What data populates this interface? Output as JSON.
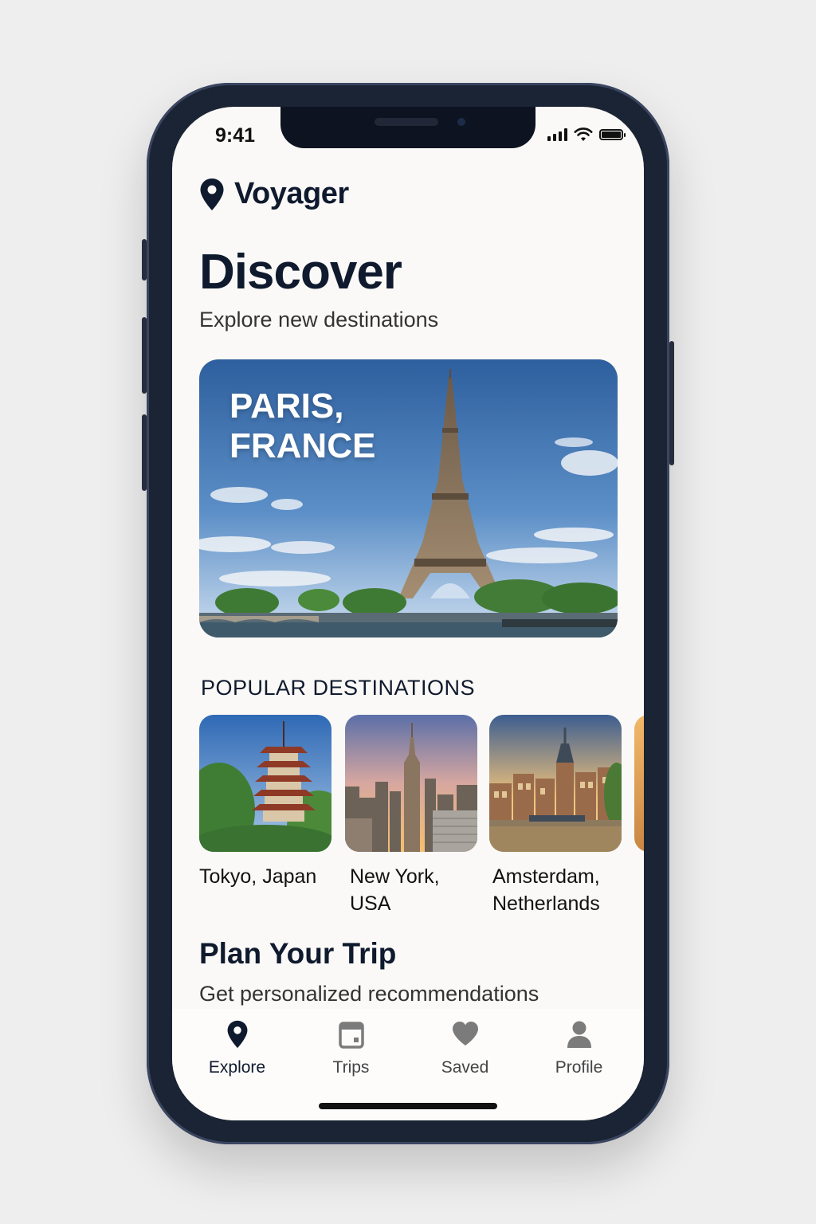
{
  "status_bar": {
    "time": "9:41"
  },
  "app": {
    "name": "Voyager"
  },
  "header": {
    "title": "Discover",
    "subtitle": "Explore new destinations"
  },
  "featured": {
    "title": "PARIS, FRANCE"
  },
  "popular": {
    "heading": "POPULAR DESTINATIONS",
    "items": [
      {
        "label": "Tokyo, Japan"
      },
      {
        "label": "New York, USA"
      },
      {
        "label": "Amsterdam, Netherlands"
      }
    ]
  },
  "plan": {
    "title": "Plan Your Trip",
    "subtitle": "Get personalized recommendations"
  },
  "tabs": [
    {
      "label": "Explore",
      "icon": "map-pin-icon",
      "active": true
    },
    {
      "label": "Trips",
      "icon": "calendar-icon",
      "active": false
    },
    {
      "label": "Saved",
      "icon": "heart-icon",
      "active": false
    },
    {
      "label": "Profile",
      "icon": "user-icon",
      "active": false
    }
  ],
  "colors": {
    "accent": "#0f1a2e",
    "inactive_icon": "#7b7b7b"
  }
}
